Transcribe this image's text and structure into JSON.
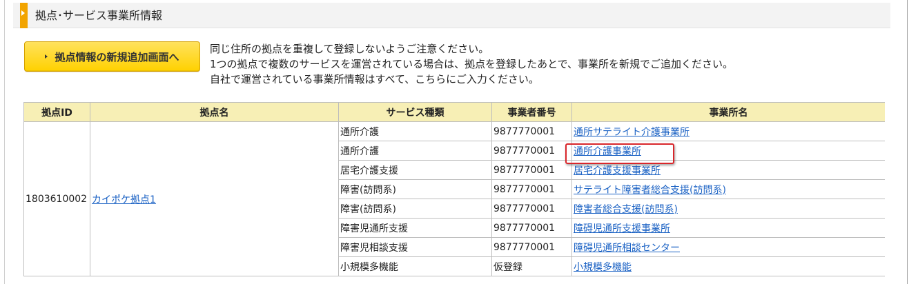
{
  "section": {
    "title": "拠点･サービス事業所情報"
  },
  "toolbar": {
    "add_label": "拠点情報の新規追加画面へ"
  },
  "notice": {
    "lines": [
      "同じ住所の拠点を重複して登録しないようご注意ください。",
      "1つの拠点で複数のサービスを運営されている場合は、拠点を登録したあとで、事業所を新規でご追加ください。",
      "自社で運営されている事業所情報はすべて、こちらにご入力ください。"
    ]
  },
  "table": {
    "headers": [
      "拠点ID",
      "拠点名",
      "サービス種類",
      "事業者番号",
      "事業所名"
    ],
    "base": {
      "id": "1803610002",
      "name": "カイポケ拠点1"
    },
    "rows": [
      {
        "service": "通所介護",
        "number": "9877770001",
        "office": "通所サテライト介護事業所"
      },
      {
        "service": "通所介護",
        "number": "9877770001",
        "office": "通所介護事業所"
      },
      {
        "service": "居宅介護支援",
        "number": "9877770001",
        "office": "居宅介護支援事業所"
      },
      {
        "service": "障害(訪問系)",
        "number": "9877770001",
        "office": "サテライト障害者総合支援(訪問系)"
      },
      {
        "service": "障害(訪問系)",
        "number": "9877770001",
        "office": "障害者総合支援(訪問系)"
      },
      {
        "service": "障害児通所支援",
        "number": "9877770001",
        "office": "障碍児通所支援事業所"
      },
      {
        "service": "障害児相談支援",
        "number": "9877770001",
        "office": "障碍児通所相談センター"
      },
      {
        "service": "小規模多機能",
        "number": "仮登録",
        "office": "小規模多機能"
      }
    ]
  },
  "colors": {
    "accent": "#f2a400",
    "button": "#ffd100",
    "table_header": "#f7efb5",
    "link": "#1b62c4",
    "highlight": "#d9262b"
  },
  "icons": {
    "header_marker": "chevron-right-icon",
    "button_arrow": "chevron-right-icon"
  }
}
